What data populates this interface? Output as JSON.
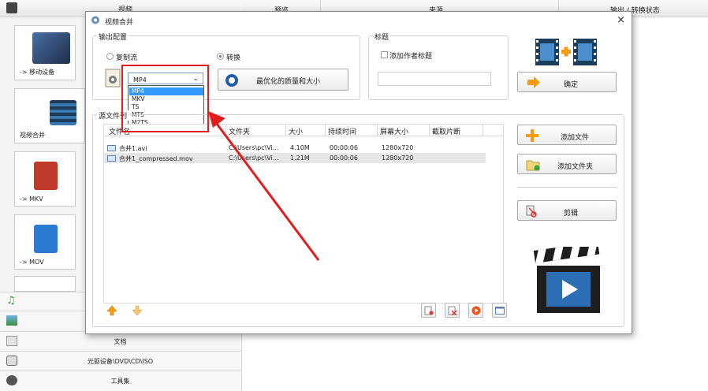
{
  "app": {
    "category_header": "视频",
    "tiles": [
      {
        "caption": "-> 移动设备"
      },
      {
        "caption": "视频合并"
      },
      {
        "caption": "-> MKV"
      },
      {
        "caption": "-> MOV"
      }
    ],
    "bottom_rows": [
      {
        "label": ""
      },
      {
        "label": ""
      },
      {
        "label": "文档"
      },
      {
        "label": "光驱设备\\DVD\\CD\\ISO"
      },
      {
        "label": "工具集"
      }
    ],
    "columns": {
      "preview": "预览",
      "source": "来源",
      "output": "输出 / 转换状态"
    }
  },
  "dialog": {
    "title": "视频合并",
    "close_glyph": "×",
    "output_group": {
      "label": "输出配置",
      "radio_copy": "复制流",
      "radio_convert": "转换",
      "format_value": "MP4",
      "format_options": [
        "MP4",
        "MKV",
        "TS",
        "MTS",
        "M2TS"
      ],
      "quality_button": "最优化的质量和大小"
    },
    "title_group": {
      "label": "标题",
      "add_author_title": "添加作者标题",
      "title_text": ""
    },
    "ok_button": "确定",
    "source_group": {
      "label": "源文件列",
      "headers": {
        "name": "文件名",
        "folder": "文件夹",
        "size": "大小",
        "duration": "持续时间",
        "screen": "屏幕大小",
        "clip": "截取片断"
      },
      "rows": [
        {
          "name": "合并1.avi",
          "folder": "C:\\Users\\pc\\Vi...",
          "size": "4.10M",
          "duration": "00:00:06",
          "screen": "1280x720",
          "clip": ""
        },
        {
          "name": "合并1_compressed.mov",
          "folder": "C:\\Users\\pc\\Vi...",
          "size": "1.21M",
          "duration": "00:00:06",
          "screen": "1280x720",
          "clip": ""
        }
      ]
    },
    "side_buttons": {
      "add_file": "添加文件",
      "add_folder": "添加文件夹",
      "edit": "剪辑"
    },
    "colors": {
      "annotation": "#e01e1e",
      "selection": "#3399ff",
      "plus": "#f39c12"
    }
  }
}
